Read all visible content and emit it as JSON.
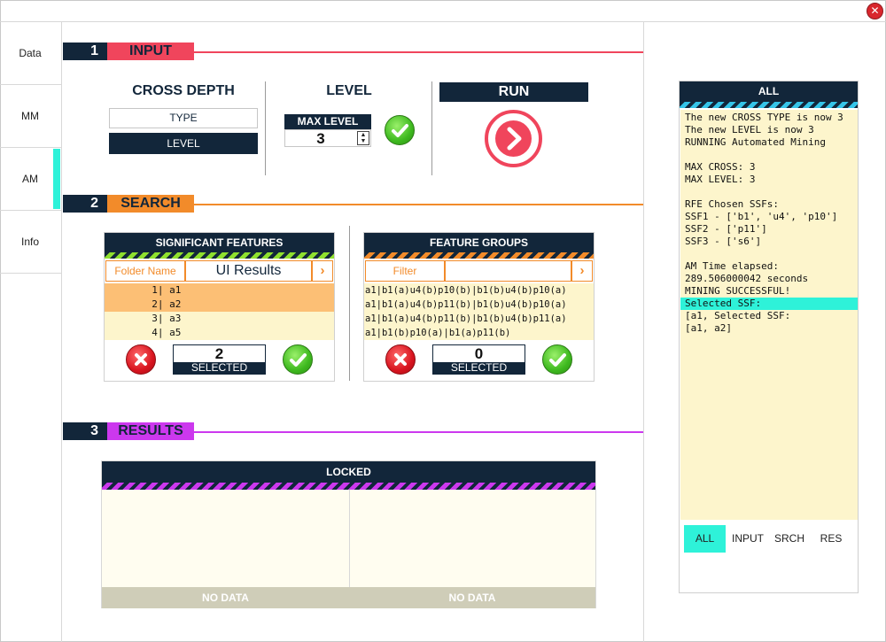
{
  "window": {
    "close_icon": "close-icon",
    "accent_colors": {
      "input": "#f0455c",
      "search": "#f28b2a",
      "results": "#cc38ee",
      "am": "#2ef2d9",
      "navy": "#12263a"
    }
  },
  "sidebar": {
    "items": [
      {
        "label": "Data"
      },
      {
        "label": "MM"
      },
      {
        "label": "AM"
      },
      {
        "label": "Info"
      }
    ]
  },
  "input": {
    "number": "1",
    "title": "INPUT",
    "cross_depth": {
      "heading": "CROSS DEPTH",
      "type_label": "TYPE",
      "level_label": "LEVEL"
    },
    "level": {
      "heading": "LEVEL",
      "max_level_label": "MAX LEVEL",
      "max_level_value": "3"
    },
    "run": {
      "label": "RUN"
    }
  },
  "search": {
    "number": "2",
    "title": "SEARCH",
    "significant_features": {
      "title": "SIGNIFICANT FEATURES",
      "folder_label": "Folder Name",
      "folder_value": "UI Results",
      "items": [
        {
          "text": "  1| a1"
        },
        {
          "text": "  2| a2"
        },
        {
          "text": "  3| a3"
        },
        {
          "text": "  4| a5"
        }
      ],
      "count": "2",
      "count_label": "SELECTED"
    },
    "feature_groups": {
      "title": "FEATURE GROUPS",
      "filter_placeholder": "Filter",
      "items": [
        {
          "text": "a1|b1(a)u4(b)p10(b)|b1(b)u4(b)p10(a)"
        },
        {
          "text": "a1|b1(a)u4(b)p11(b)|b1(b)u4(b)p10(a)"
        },
        {
          "text": "a1|b1(a)u4(b)p11(b)|b1(b)u4(b)p11(a)"
        },
        {
          "text": "a1|b1(b)p10(a)|b1(a)p11(b)"
        }
      ],
      "count": "0",
      "count_label": "SELECTED"
    }
  },
  "results": {
    "number": "3",
    "title": "RESULTS",
    "panel_title": "LOCKED",
    "left_footer": "NO DATA",
    "right_footer": "NO DATA"
  },
  "log": {
    "title": "ALL",
    "lines": [
      "The new CROSS TYPE is now 3",
      "The new LEVEL is now 3",
      "RUNNING Automated Mining",
      "",
      "MAX CROSS: 3",
      "MAX LEVEL: 3",
      "",
      "RFE Chosen SSFs:",
      "SSF1 - ['b1', 'u4', 'p10']",
      "SSF2 - ['p11']",
      "SSF3 - ['s6']",
      "",
      "AM Time elapsed:",
      "289.506000042 seconds",
      "MINING SUCCESSFUL!",
      "Selected SSF:",
      "[a1, Selected SSF:",
      "[a1, a2]"
    ],
    "filters": [
      {
        "label": "ALL"
      },
      {
        "label": "INPUT"
      },
      {
        "label": "SRCH"
      },
      {
        "label": "RES"
      }
    ]
  }
}
